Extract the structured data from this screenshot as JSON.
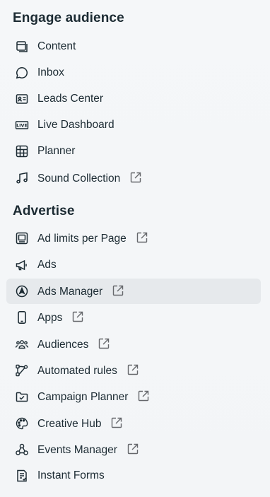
{
  "sections": [
    {
      "title": "Engage audience",
      "items": [
        {
          "label": "Content",
          "icon": "content-icon",
          "external": false
        },
        {
          "label": "Inbox",
          "icon": "chat-bubble-icon",
          "external": false
        },
        {
          "label": "Leads Center",
          "icon": "contact-card-icon",
          "external": false
        },
        {
          "label": "Live Dashboard",
          "icon": "live-badge-icon",
          "external": false
        },
        {
          "label": "Planner",
          "icon": "calendar-grid-icon",
          "external": false
        },
        {
          "label": "Sound Collection",
          "icon": "music-note-icon",
          "external": true
        }
      ]
    },
    {
      "title": "Advertise",
      "items": [
        {
          "label": "Ad limits per Page",
          "icon": "monitor-icon",
          "external": true
        },
        {
          "label": "Ads",
          "icon": "megaphone-icon",
          "external": false
        },
        {
          "label": "Ads Manager",
          "icon": "navigation-arrow-icon",
          "external": true,
          "active": true
        },
        {
          "label": "Apps",
          "icon": "phone-icon",
          "external": true
        },
        {
          "label": "Audiences",
          "icon": "people-icon",
          "external": true
        },
        {
          "label": "Automated rules",
          "icon": "rules-flow-icon",
          "external": true
        },
        {
          "label": "Campaign Planner",
          "icon": "folder-check-icon",
          "external": true
        },
        {
          "label": "Creative Hub",
          "icon": "palette-icon",
          "external": true
        },
        {
          "label": "Events Manager",
          "icon": "events-network-icon",
          "external": true
        },
        {
          "label": "Instant Forms",
          "icon": "form-document-icon",
          "external": false
        }
      ]
    }
  ],
  "colors": {
    "text": "#1c2b33",
    "icon": "#1c2b33",
    "external_icon": "#65676b",
    "active_bg": "#e6e9ec",
    "panel_bg": "#f4f6f8"
  }
}
